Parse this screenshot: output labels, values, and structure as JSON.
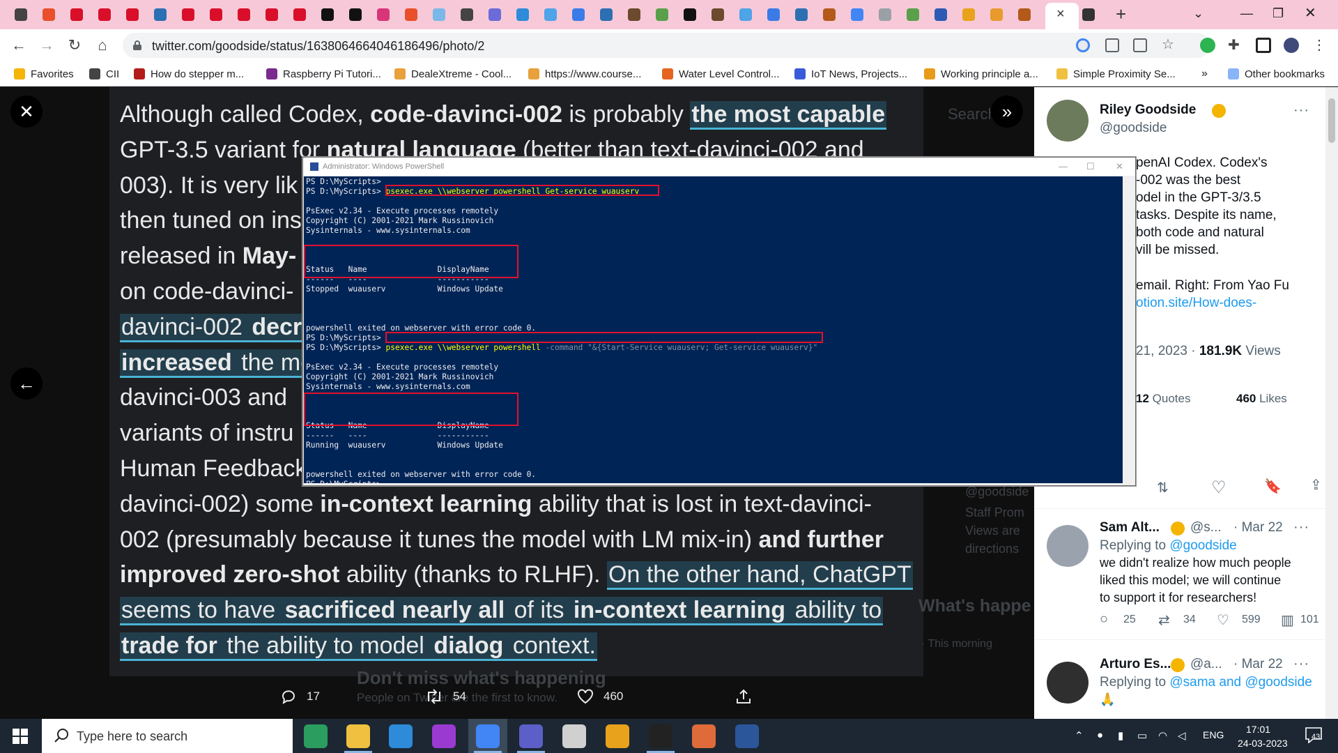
{
  "browser": {
    "url": "twitter.com/goodside/status/1638064664046186496/photo/2",
    "bookmarks": [
      {
        "label": "Favorites",
        "color": "#f4b400"
      },
      {
        "label": "CII",
        "color": "#444444"
      },
      {
        "label": "How do stepper m...",
        "color": "#b31b1b"
      },
      {
        "label": "Raspberry Pi Tutori...",
        "color": "#7b2a8f"
      },
      {
        "label": "DealeXtreme - Cool...",
        "color": "#e8a13b"
      },
      {
        "label": "https://www.course...",
        "color": "#e8a13b"
      },
      {
        "label": "Water Level Control...",
        "color": "#e5641f"
      },
      {
        "label": "IoT News, Projects...",
        "color": "#3a5bd9"
      },
      {
        "label": "Working principle a...",
        "color": "#e89b1b"
      },
      {
        "label": "Simple Proximity Se...",
        "color": "#f0c040"
      }
    ],
    "bookmarks_more": "»",
    "other_bookmarks": "Other bookmarks",
    "new_tab": "+",
    "tab_close": "×"
  },
  "photo": {
    "lines": [
      {
        "segs": [
          {
            "t": "Although called Codex, "
          },
          {
            "t": "code",
            "b": true
          },
          {
            "t": "-"
          },
          {
            "t": "davinci-002",
            "b": true
          },
          {
            "t": " is probably "
          },
          {
            "t": "the most capable",
            "b": true,
            "hl": true
          }
        ]
      },
      {
        "segs": [
          {
            "t": "GPT-3.5 variant for "
          },
          {
            "t": "natural language",
            "b": true
          },
          {
            "t": " (better than text-davinci-002 and"
          }
        ]
      },
      {
        "segs": [
          {
            "t": "003). It is very lik"
          }
        ]
      },
      {
        "segs": [
          {
            "t": "then tuned on ins"
          }
        ]
      },
      {
        "segs": [
          {
            "t": "released in "
          },
          {
            "t": "May-",
            "b": true
          }
        ]
      },
      {
        "segs": [
          {
            "t": "on code-davinci-"
          }
        ]
      },
      {
        "segs": [
          {
            "t": "davinci-002 ",
            "hl": true
          },
          {
            "t": "decr",
            "b": true,
            "hl": true
          }
        ]
      },
      {
        "segs": [
          {
            "t": "increased",
            "b": true,
            "hl": true
          },
          {
            "t": " the mo",
            "hl": true
          }
        ]
      },
      {
        "segs": [
          {
            "t": "davinci-003 and"
          }
        ]
      },
      {
        "segs": [
          {
            "t": "variants of instru"
          }
        ]
      },
      {
        "segs": [
          {
            "t": "Human Feedback"
          }
        ]
      },
      {
        "segs": [
          {
            "t": "davinci-002) some "
          },
          {
            "t": "in-context learning",
            "b": true
          },
          {
            "t": " ability that is lost in text-davinci-"
          }
        ]
      },
      {
        "segs": [
          {
            "t": "002 (presumably because it tunes the model with LM mix-in) "
          },
          {
            "t": "and further",
            "b": true
          }
        ]
      },
      {
        "segs": [
          {
            "t": "improved zero-shot",
            "b": true
          },
          {
            "t": " ability (thanks to RLHF). "
          },
          {
            "t": "On the other hand, ChatGPT",
            "hl": true
          }
        ]
      },
      {
        "segs": [
          {
            "t": "seems to have ",
            "hl": true
          },
          {
            "t": "sacrificed nearly all",
            "b": true,
            "hl": true
          },
          {
            "t": " of its ",
            "hl": true
          },
          {
            "t": "in-context learning",
            "b": true,
            "hl": true
          },
          {
            "t": " ability to",
            "hl": true
          }
        ]
      },
      {
        "segs": [
          {
            "t": "trade for",
            "b": true,
            "hl": true
          },
          {
            "t": " the ability to model ",
            "hl": true
          },
          {
            "t": "dialog",
            "b": true,
            "hl": true
          },
          {
            "t": " context.",
            "hl": true
          }
        ]
      }
    ],
    "ghost_search": "Search",
    "ghost_whats": "What's happe",
    "ghost_dont": "Don't miss what's happening",
    "ghost_people": "People on Twitter are the first to know.",
    "ghost_staff": "Staff Prom",
    "ghost_views": "Views are",
    "ghost_directions": "directions",
    "ghost_goodside": "@goodside",
    "ghost_time": "· This morning",
    "actions": {
      "replies": "17",
      "retweets": "54",
      "likes": "460"
    }
  },
  "tweet": {
    "author_name": "Riley Goodside",
    "author_handle": "@goodside",
    "more": "···",
    "body_lines": [
      "penAI Codex. Codex's",
      "-002 was the best",
      "odel in the GPT-3/3.5",
      "tasks. Despite its name,",
      "both code and natural",
      "vill be missed."
    ],
    "credit_line": "email. Right: From Yao Fu",
    "credit_link": "otion.site/How-does-",
    "date_frag": "21, 2023 · ",
    "views_count": "181.9K",
    "views_label": " Views",
    "quotes_count": "12",
    "quotes_label": " Quotes",
    "likes_count": "460",
    "likes_label": " Likes"
  },
  "replies": [
    {
      "name": "Sam Alt...",
      "handle": "@s...",
      "date": "· Mar 22",
      "replying_prefix": "Replying to ",
      "replying_to": "@goodside",
      "text_lines": [
        "we didn't realize how much people",
        "liked this model; we will continue",
        "to support it for researchers!"
      ],
      "replies": "25",
      "retweets": "34",
      "likes": "599",
      "views": "101"
    },
    {
      "name": "Arturo Es...",
      "handle": "@a...",
      "date": "· Mar 22",
      "replying_prefix": "Replying to ",
      "replying_to": "@sama and @goodside",
      "text_lines": [
        "🙏"
      ]
    }
  ],
  "powershell": {
    "title": "Administrator: Windows PowerShell",
    "lines": [
      {
        "t": "PS D:\\MyScripts>"
      },
      {
        "t": "PS D:\\MyScripts> ",
        "cmd": "psexec.exe \\\\webserver powershell Get-service wuauserv"
      },
      {
        "t": ""
      },
      {
        "t": "PsExec v2.34 - Execute processes remotely"
      },
      {
        "t": "Copyright (C) 2001-2021 Mark Russinovich"
      },
      {
        "t": "Sysinternals - www.sysinternals.com"
      },
      {
        "t": ""
      },
      {
        "t": ""
      },
      {
        "t": ""
      },
      {
        "t": "Status   Name               DisplayName"
      },
      {
        "t": "------   ----               -----------"
      },
      {
        "t": "Stopped  wuauserv           Windows Update"
      },
      {
        "t": ""
      },
      {
        "t": ""
      },
      {
        "t": ""
      },
      {
        "t": "powershell exited on webserver with error code 0."
      },
      {
        "t": "PS D:\\MyScripts>"
      },
      {
        "t": "PS D:\\MyScripts> ",
        "cmd": "psexec.exe \\\\webserver powershell ",
        "gray": "-command \"&{Start-Service wuauserv; Get-service wuauserv}\""
      },
      {
        "t": ""
      },
      {
        "t": "PsExec v2.34 - Execute processes remotely"
      },
      {
        "t": "Copyright (C) 2001-2021 Mark Russinovich"
      },
      {
        "t": "Sysinternals - www.sysinternals.com"
      },
      {
        "t": ""
      },
      {
        "t": ""
      },
      {
        "t": ""
      },
      {
        "t": "Status   Name               DisplayName"
      },
      {
        "t": "------   ----               -----------"
      },
      {
        "t": "Running  wuauserv           Windows Update"
      },
      {
        "t": ""
      },
      {
        "t": ""
      },
      {
        "t": "powershell exited on webserver with error code 0."
      },
      {
        "t": "PS D:\\MyScripts>"
      }
    ]
  },
  "taskbar": {
    "search_placeholder": "Type here to search",
    "lang": "ENG",
    "time": "17:01",
    "date": "24-03-2023",
    "notifications": "43"
  }
}
